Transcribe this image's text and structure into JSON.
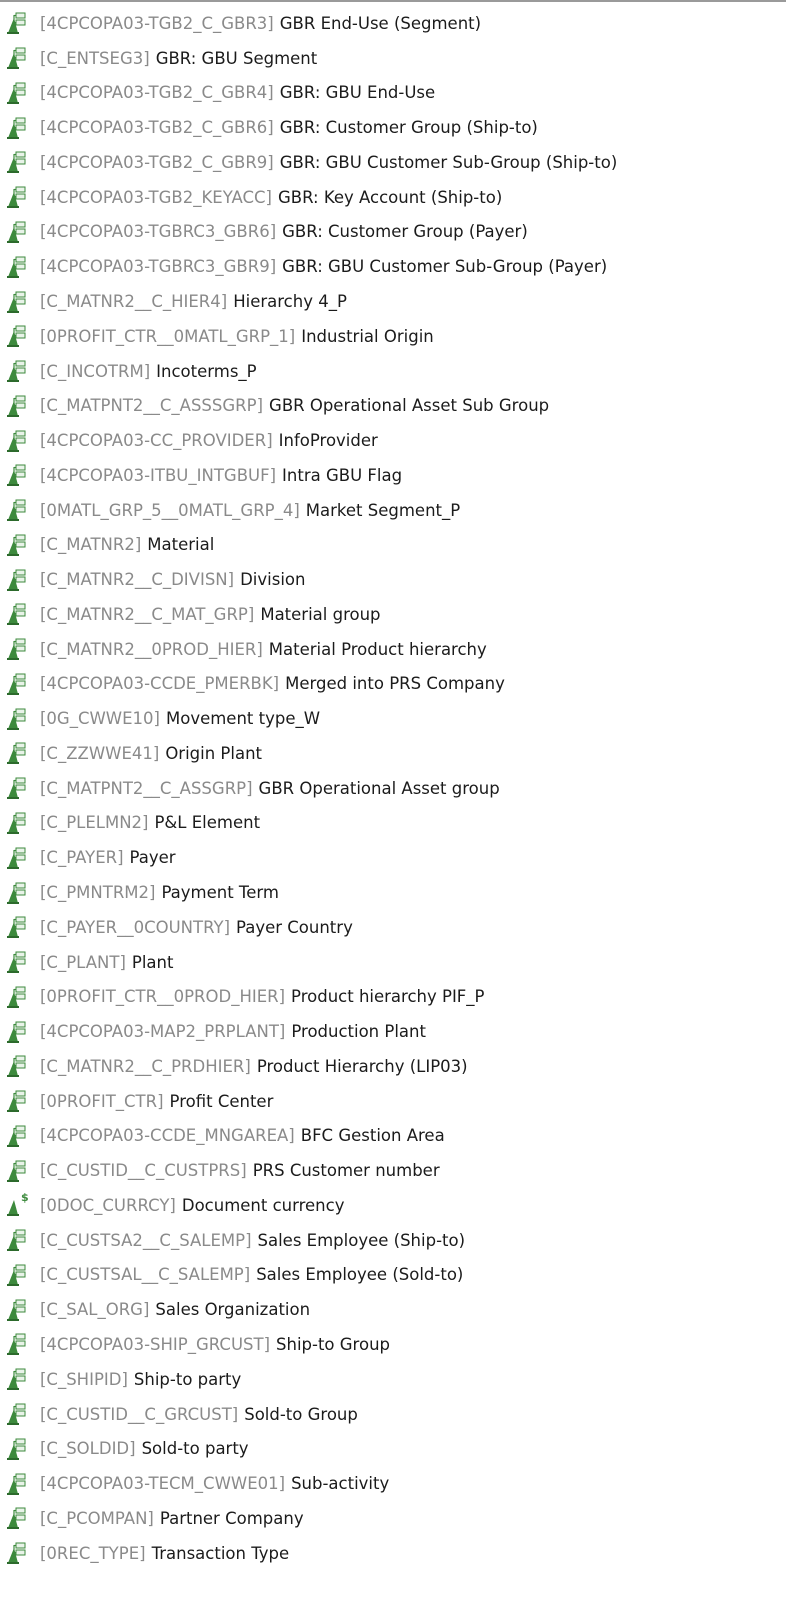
{
  "colors": {
    "technical_name": "#8a8a8a",
    "label": "#1b1b1b",
    "icon_green": "#3d8a3d"
  },
  "items": [
    {
      "tech": "[4CPCOPA03-TGB2_C_GBR3]",
      "label": "GBR End-Use (Segment)",
      "icon": "dimension-icon"
    },
    {
      "tech": "[C_ENTSEG3]",
      "label": "GBR: GBU Segment",
      "icon": "dimension-icon"
    },
    {
      "tech": "[4CPCOPA03-TGB2_C_GBR4]",
      "label": "GBR: GBU End-Use",
      "icon": "dimension-icon"
    },
    {
      "tech": "[4CPCOPA03-TGB2_C_GBR6]",
      "label": "GBR: Customer Group (Ship-to)",
      "icon": "dimension-icon"
    },
    {
      "tech": "[4CPCOPA03-TGB2_C_GBR9]",
      "label": "GBR: GBU Customer Sub-Group (Ship-to)",
      "icon": "dimension-icon"
    },
    {
      "tech": "[4CPCOPA03-TGB2_KEYACC]",
      "label": "GBR: Key Account (Ship-to)",
      "icon": "dimension-icon"
    },
    {
      "tech": "[4CPCOPA03-TGBRC3_GBR6]",
      "label": "GBR: Customer Group (Payer)",
      "icon": "dimension-icon"
    },
    {
      "tech": "[4CPCOPA03-TGBRC3_GBR9]",
      "label": "GBR: GBU Customer Sub-Group (Payer)",
      "icon": "dimension-icon"
    },
    {
      "tech": "[C_MATNR2__C_HIER4]",
      "label": "Hierarchy 4_P",
      "icon": "dimension-icon"
    },
    {
      "tech": "[0PROFIT_CTR__0MATL_GRP_1]",
      "label": "Industrial Origin",
      "icon": "dimension-icon"
    },
    {
      "tech": "[C_INCOTRM]",
      "label": "Incoterms_P",
      "icon": "dimension-icon"
    },
    {
      "tech": "[C_MATPNT2__C_ASSSGRP]",
      "label": "GBR Operational Asset Sub Group",
      "icon": "dimension-icon"
    },
    {
      "tech": "[4CPCOPA03-CC_PROVIDER]",
      "label": "InfoProvider",
      "icon": "dimension-icon"
    },
    {
      "tech": "[4CPCOPA03-ITBU_INTGBUF]",
      "label": "Intra GBU Flag",
      "icon": "dimension-icon"
    },
    {
      "tech": "[0MATL_GRP_5__0MATL_GRP_4]",
      "label": "Market Segment_P",
      "icon": "dimension-icon"
    },
    {
      "tech": "[C_MATNR2]",
      "label": "Material",
      "icon": "dimension-icon"
    },
    {
      "tech": "[C_MATNR2__C_DIVISN]",
      "label": "Division",
      "icon": "dimension-icon"
    },
    {
      "tech": "[C_MATNR2__C_MAT_GRP]",
      "label": "Material group",
      "icon": "dimension-icon"
    },
    {
      "tech": "[C_MATNR2__0PROD_HIER]",
      "label": "Material Product hierarchy",
      "icon": "dimension-icon"
    },
    {
      "tech": "[4CPCOPA03-CCDE_PMERBK]",
      "label": "Merged into PRS Company",
      "icon": "dimension-icon"
    },
    {
      "tech": "[0G_CWWE10]",
      "label": "Movement type_W",
      "icon": "dimension-icon"
    },
    {
      "tech": "[C_ZZWWE41]",
      "label": "Origin Plant",
      "icon": "dimension-icon"
    },
    {
      "tech": "[C_MATPNT2__C_ASSGRP]",
      "label": "GBR Operational Asset group",
      "icon": "dimension-icon"
    },
    {
      "tech": "[C_PLELMN2]",
      "label": "P&L Element",
      "icon": "dimension-icon"
    },
    {
      "tech": "[C_PAYER]",
      "label": "Payer",
      "icon": "dimension-icon"
    },
    {
      "tech": "[C_PMNTRM2]",
      "label": "Payment Term",
      "icon": "dimension-icon"
    },
    {
      "tech": "[C_PAYER__0COUNTRY]",
      "label": "Payer Country",
      "icon": "dimension-icon"
    },
    {
      "tech": "[C_PLANT]",
      "label": "Plant",
      "icon": "dimension-icon"
    },
    {
      "tech": "[0PROFIT_CTR__0PROD_HIER]",
      "label": "Product hierarchy PIF_P",
      "icon": "dimension-icon"
    },
    {
      "tech": "[4CPCOPA03-MAP2_PRPLANT]",
      "label": "Production Plant",
      "icon": "dimension-icon"
    },
    {
      "tech": "[C_MATNR2__C_PRDHIER]",
      "label": "Product Hierarchy (LIP03)",
      "icon": "dimension-icon"
    },
    {
      "tech": "[0PROFIT_CTR]",
      "label": "Profit Center",
      "icon": "dimension-icon"
    },
    {
      "tech": "[4CPCOPA03-CCDE_MNGAREA]",
      "label": "BFC Gestion Area",
      "icon": "dimension-icon"
    },
    {
      "tech": "[C_CUSTID__C_CUSTPRS]",
      "label": "PRS Customer number",
      "icon": "dimension-icon"
    },
    {
      "tech": "[0DOC_CURRCY]",
      "label": "Document currency",
      "icon": "currency-dimension-icon",
      "badge": "$"
    },
    {
      "tech": "[C_CUSTSA2__C_SALEMP]",
      "label": "Sales Employee (Ship-to)",
      "icon": "dimension-icon"
    },
    {
      "tech": "[C_CUSTSAL__C_SALEMP]",
      "label": "Sales Employee (Sold-to)",
      "icon": "dimension-icon"
    },
    {
      "tech": "[C_SAL_ORG]",
      "label": "Sales Organization",
      "icon": "dimension-icon"
    },
    {
      "tech": "[4CPCOPA03-SHIP_GRCUST]",
      "label": "Ship-to Group",
      "icon": "dimension-icon"
    },
    {
      "tech": "[C_SHIPID]",
      "label": "Ship-to party",
      "icon": "dimension-icon"
    },
    {
      "tech": "[C_CUSTID__C_GRCUST]",
      "label": "Sold-to Group",
      "icon": "dimension-icon"
    },
    {
      "tech": "[C_SOLDID]",
      "label": "Sold-to party",
      "icon": "dimension-icon"
    },
    {
      "tech": "[4CPCOPA03-TECM_CWWE01]",
      "label": "Sub-activity",
      "icon": "dimension-icon"
    },
    {
      "tech": "[C_PCOMPAN]",
      "label": "Partner Company",
      "icon": "dimension-icon"
    },
    {
      "tech": "[0REC_TYPE]",
      "label": "Transaction Type",
      "icon": "dimension-icon"
    }
  ]
}
